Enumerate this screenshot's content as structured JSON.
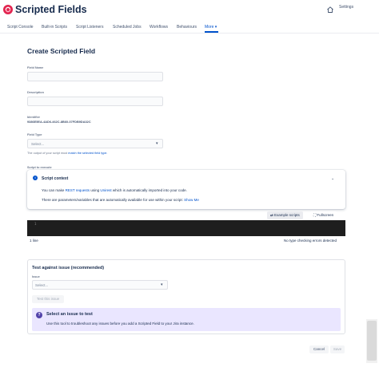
{
  "header": {
    "title": "Scripted Fields",
    "settings_label": "Settings"
  },
  "nav": {
    "items": [
      "Script Console",
      "Built-in Scripts",
      "Script Listeners",
      "Scheduled Jobs",
      "Workflows",
      "Behaviours",
      "More"
    ],
    "active": "More"
  },
  "form": {
    "title": "Create Scripted Field",
    "field_name_label": "Field Name",
    "field_name_value": "",
    "description_label": "Description",
    "description_value": "",
    "identifier_label": "Identifier",
    "identifier_value": "9386E5EA-4AD6-462C-8B60-07FDB9DA32C",
    "field_type_label": "Field Type",
    "field_type_placeholder": "Select...",
    "field_type_helper_prefix": "The output of your script must",
    "field_type_helper_link": "match the selected field type.",
    "script_label": "Script to execute"
  },
  "script_context": {
    "title": "Script context",
    "line1_prefix": "You can make",
    "line1_link1": "REST requests",
    "line1_mid": "using",
    "line1_link2": "Unirest",
    "line1_suffix": "which is automatically imported into your code.",
    "line2_prefix": "There are parameters/variables that are automatically available for use within your script:",
    "line2_link": "Show Me"
  },
  "editor": {
    "example_scripts_label": "Example scripts",
    "fullscreen_label": "Fullscreen",
    "line_number": "1",
    "status_left": "1 line",
    "status_right": "No type checking errors detected"
  },
  "test": {
    "title": "Test against issue (recommended)",
    "issue_label": "Issue",
    "issue_placeholder": "Select...",
    "test_button": "Test this issue",
    "banner_title": "Select an issue to test",
    "banner_text": "Use this tool to troubleshoot any issues before you add a Scripted Field to your Jira instance."
  },
  "footer": {
    "cancel_label": "Cancel",
    "save_label": "Save"
  },
  "colors": {
    "brand": "#e2244f",
    "link": "#0052cc",
    "editor_bg": "#1e1e1e",
    "banner_bg": "#eae6ff"
  }
}
